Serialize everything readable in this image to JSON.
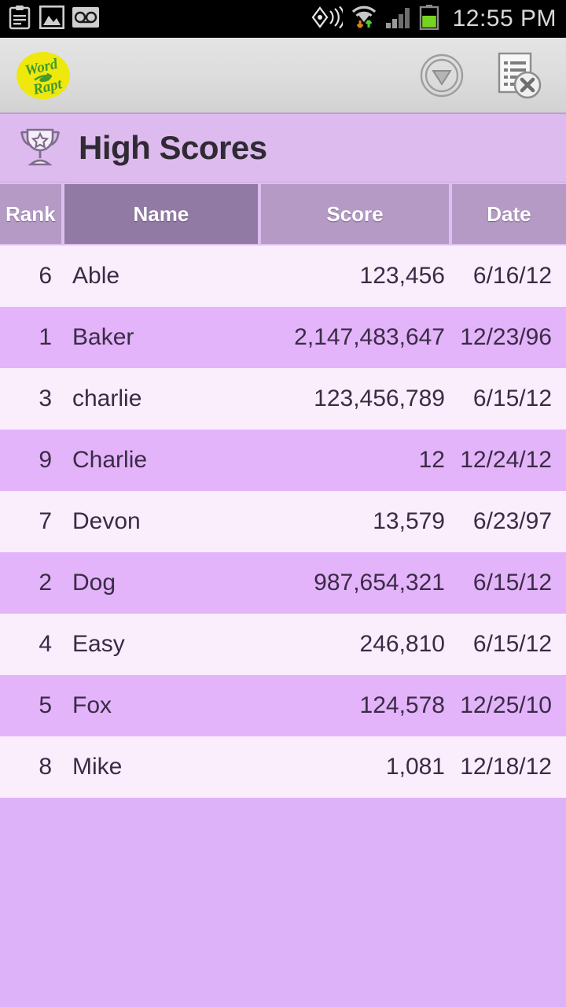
{
  "status_bar": {
    "time": "12:55 PM",
    "left_icons": [
      "clipboard-icon",
      "gallery-image-icon",
      "voicemail-icon"
    ],
    "right_icons": [
      "gps-location-icon",
      "wifi-icon",
      "cellular-signal-icon",
      "battery-icon"
    ]
  },
  "app_bar": {
    "logo_line1": "Word",
    "logo_line2": "Rapt",
    "logo_bg": "#efe80d",
    "logo_text_color": "#3f9b2f",
    "actions": [
      {
        "name": "collapse-download-button",
        "icon": "circle-chevron-down-icon"
      },
      {
        "name": "clear-list-button",
        "icon": "list-remove-icon"
      }
    ]
  },
  "title_bar": {
    "icon": "trophy-icon",
    "title": "High Scores"
  },
  "table": {
    "columns": [
      {
        "key": "rank",
        "label": "Rank",
        "active": false
      },
      {
        "key": "name",
        "label": "Name",
        "active": true
      },
      {
        "key": "score",
        "label": "Score",
        "active": false
      },
      {
        "key": "date",
        "label": "Date",
        "active": false
      }
    ],
    "sorted_by": "Name",
    "rows": [
      {
        "rank": "6",
        "name": "Able",
        "score": "123,456",
        "date": "6/16/12"
      },
      {
        "rank": "1",
        "name": "Baker",
        "score": "2,147,483,647",
        "date": "12/23/96"
      },
      {
        "rank": "3",
        "name": "charlie",
        "score": "123,456,789",
        "date": "6/15/12"
      },
      {
        "rank": "9",
        "name": "Charlie",
        "score": "12",
        "date": "12/24/12"
      },
      {
        "rank": "7",
        "name": "Devon",
        "score": "13,579",
        "date": "6/23/97"
      },
      {
        "rank": "2",
        "name": "Dog",
        "score": "987,654,321",
        "date": "6/15/12"
      },
      {
        "rank": "4",
        "name": "Easy",
        "score": "246,810",
        "date": "6/15/12"
      },
      {
        "rank": "5",
        "name": "Fox",
        "score": "124,578",
        "date": "12/25/10"
      },
      {
        "rank": "8",
        "name": "Mike",
        "score": "1,081",
        "date": "12/18/12"
      }
    ]
  },
  "colors": {
    "row_odd": "#faeefc",
    "row_even": "#e3b4fa",
    "header_cell": "#b49ac4",
    "header_cell_active": "#917aa3",
    "title_bar": "#ddbbee",
    "page_background": "#deb2f8",
    "app_bar": "#dcdcdc"
  }
}
